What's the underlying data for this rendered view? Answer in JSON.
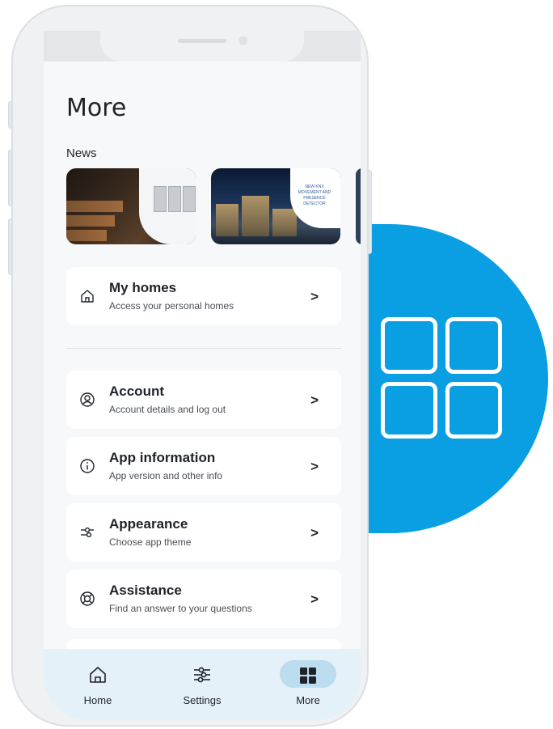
{
  "page": {
    "title": "More",
    "news_label": "News"
  },
  "news": [
    {
      "name": "news-card-lighting",
      "caption": ""
    },
    {
      "name": "news-card-knx",
      "caption": "NEW KNX MOVEMENT AND PRESENCE DETECTOR"
    },
    {
      "name": "news-card-partial",
      "caption": ""
    }
  ],
  "menu": {
    "my_homes": {
      "title": "My homes",
      "subtitle": "Access your personal homes",
      "icon": "home-icon"
    },
    "account": {
      "title": "Account",
      "subtitle": "Account details and log out",
      "icon": "user-circle-icon"
    },
    "app_information": {
      "title": "App information",
      "subtitle": "App version and other info",
      "icon": "info-icon"
    },
    "appearance": {
      "title": "Appearance",
      "subtitle": "Choose app theme",
      "icon": "sliders-icon"
    },
    "assistance": {
      "title": "Assistance",
      "subtitle": "Find an answer to your questions",
      "icon": "lifebuoy-icon"
    },
    "chevron": ">"
  },
  "nav": {
    "home": "Home",
    "settings": "Settings",
    "more": "More",
    "active": "more"
  },
  "colors": {
    "accent": "#0a9ee2",
    "nav_background": "#e4f1f8",
    "active_pill": "#bcdcf0"
  }
}
